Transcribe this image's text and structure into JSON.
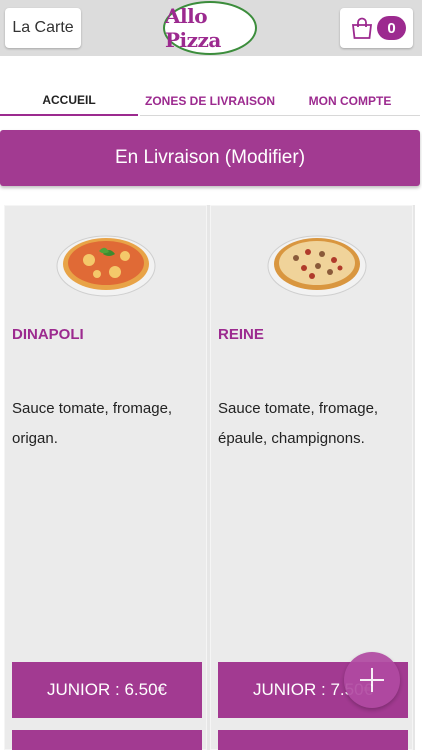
{
  "header": {
    "menu_label": "La Carte",
    "logo_text": "Allo Pizza",
    "cart_count": "0"
  },
  "tabs": [
    {
      "label": "ACCUEIL"
    },
    {
      "label": "ZONES DE LIVRAISON"
    },
    {
      "label": "MON COMPTE"
    }
  ],
  "delivery": {
    "label": "En Livraison (Modifier)"
  },
  "products": [
    {
      "name": "DINAPOLI",
      "description": "Sauce tomate, fromage, origan.",
      "price_label": "JUNIOR : 6.50€"
    },
    {
      "name": "REINE",
      "description": "Sauce tomate, fromage, épaule, champignons.",
      "price_label": "JUNIOR : 7.50€"
    }
  ],
  "colors": {
    "accent": "#9c2a8f",
    "bar": "#a23a91",
    "logo_ring": "#3c8d3c"
  },
  "icons": {
    "cart": "shopping-bag-icon",
    "add": "plus-icon"
  }
}
